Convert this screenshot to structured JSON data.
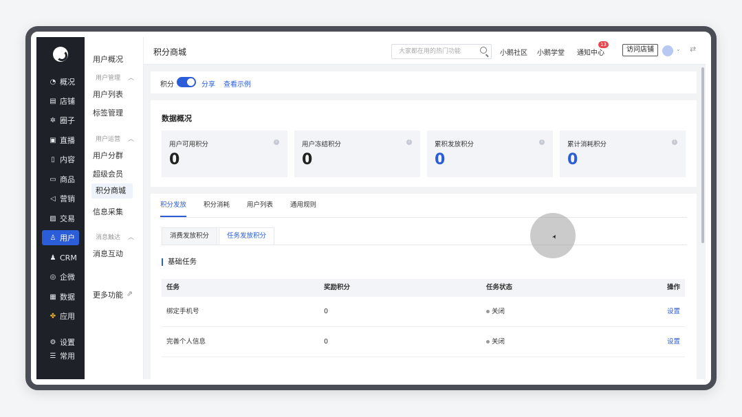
{
  "nav": {
    "items": [
      {
        "label": "概况",
        "icon": "pie-icon"
      },
      {
        "label": "店铺",
        "icon": "store-icon"
      },
      {
        "label": "圈子",
        "icon": "group-icon"
      },
      {
        "label": "直播",
        "icon": "live-icon"
      },
      {
        "label": "内容",
        "icon": "content-icon"
      },
      {
        "label": "商品",
        "icon": "goods-icon"
      },
      {
        "label": "营销",
        "icon": "megaphone-icon"
      },
      {
        "label": "交易",
        "icon": "trade-icon"
      },
      {
        "label": "用户",
        "icon": "user-icon"
      },
      {
        "label": "CRM",
        "icon": "crm-icon"
      },
      {
        "label": "企微",
        "icon": "wecom-icon"
      },
      {
        "label": "数据",
        "icon": "data-icon"
      },
      {
        "label": "应用",
        "icon": "apps-icon"
      },
      {
        "label": "设置",
        "icon": "gear-icon"
      },
      {
        "label": "常用",
        "icon": "menu-icon"
      }
    ]
  },
  "sub": {
    "overview": "用户概况",
    "group_manage": "用户管理",
    "user_list": "用户列表",
    "tag_manage": "标签管理",
    "group_ops": "用户运营",
    "user_segment": "用户分群",
    "super_member": "超级会员",
    "points_mall": "积分商城",
    "info_collect": "信息采集",
    "group_msg": "消息触达",
    "msg_interact": "消息互动",
    "more": "更多功能"
  },
  "topbar": {
    "title": "积分商城",
    "search_placeholder": "大家都在用的热门功能",
    "community": "小鹅社区",
    "academy": "小鹅学堂",
    "notify": "通知中心",
    "notify_count": "13",
    "visit_store": "访问店铺"
  },
  "toggle": {
    "label": "积分",
    "share": "分享",
    "example": "查看示例"
  },
  "stats": {
    "title": "数据概况",
    "cards": [
      {
        "label": "用户可用积分",
        "value": "0"
      },
      {
        "label": "用户冻结积分",
        "value": "0"
      },
      {
        "label": "累积发放积分",
        "value": "0"
      },
      {
        "label": "累计消耗积分",
        "value": "0"
      }
    ]
  },
  "tabs": [
    "积分发放",
    "积分消耗",
    "用户列表",
    "通用规则"
  ],
  "subtabs": [
    "消费发放积分",
    "任务发放积分"
  ],
  "section_title": "基础任务",
  "table": {
    "headers": [
      "任务",
      "奖励积分",
      "任务状态",
      "操作"
    ],
    "rows": [
      {
        "task": "绑定手机号",
        "points": "0",
        "status": "关闭",
        "action": "设置"
      },
      {
        "task": "完善个人信息",
        "points": "0",
        "status": "关闭",
        "action": "设置"
      }
    ]
  },
  "colors": {
    "accent": "#2b5dd9",
    "nav_bg": "#1e2128"
  }
}
